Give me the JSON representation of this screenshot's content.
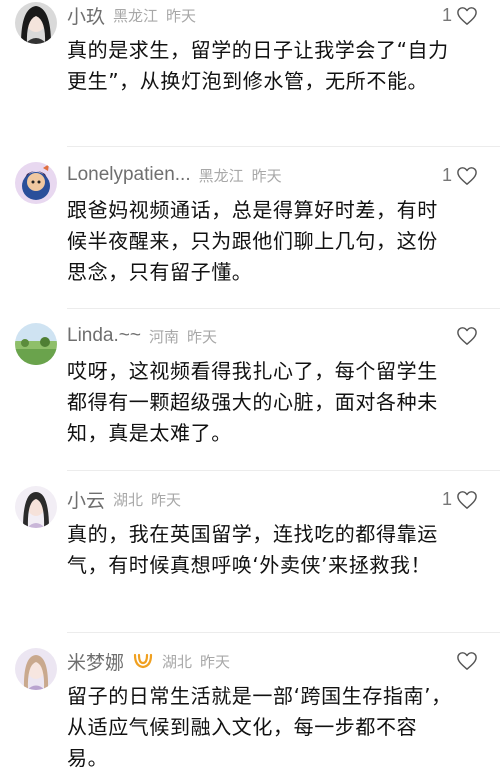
{
  "comments": [
    {
      "username": "小玖",
      "location": "黑龙江",
      "time": "昨天",
      "likes": "1",
      "text": "真的是求生，留学的日子让我学会了“自力更生”，从换灯泡到修水管，无所不能。"
    },
    {
      "username": "Lonelypatien...",
      "location": "黑龙江",
      "time": "昨天",
      "likes": "1",
      "text": "跟爸妈视频通话，总是得算好时差，有时候半夜醒来，只为跟他们聊上几句，这份思念，只有留子懂。"
    },
    {
      "username": "Linda.~~",
      "location": "河南",
      "time": "昨天",
      "likes": "",
      "text": "哎呀，这视频看得我扎心了，每个留学生都得有一颗超级强大的心脏，面对各种未知，真是太难了。"
    },
    {
      "username": "小云",
      "location": "湖北",
      "time": "昨天",
      "likes": "1",
      "text": "真的，我在英国留学，连找吃的都得靠运气，有时候真想呼唤‘外卖侠’来拯救我！"
    },
    {
      "username": "米梦娜",
      "location": "湖北",
      "time": "昨天",
      "likes": "",
      "text": "留子的日常生活就是一部‘跨国生存指南’，从适应气候到融入文化，每一步都不容易。"
    }
  ],
  "colors": {
    "username": "#6f6f6f",
    "meta": "#a8a8a8",
    "body_text": "#111111",
    "badge": "#f0a020"
  },
  "icons": {
    "like": "heart-outline-icon",
    "badge": "membership-badge-icon"
  }
}
